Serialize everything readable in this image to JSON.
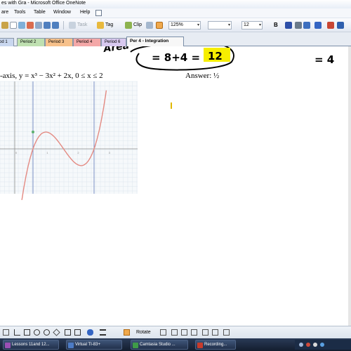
{
  "window": {
    "title": "es with Gra - Microsoft Office OneNote"
  },
  "menu": {
    "items": [
      "are",
      "Tools",
      "Table",
      "Window",
      "Help"
    ]
  },
  "toolbar": {
    "task_label": "Task",
    "tag_label": "Tag",
    "clip_label": "Clip",
    "zoom_value": "125%",
    "font_size_value": "12",
    "bold_label": "B"
  },
  "tabs": [
    {
      "label": "od 1",
      "color": "#c9d7ef"
    },
    {
      "label": "Period 2",
      "color": "#bfe0b1"
    },
    {
      "label": "Period 3",
      "color": "#f7c18b"
    },
    {
      "label": "Period 4",
      "color": "#f4a8a8"
    },
    {
      "label": "Period 6",
      "color": "#d8c9ef"
    },
    {
      "label": "Per 4 - Integration",
      "color": "#f7f7f7",
      "active": true
    }
  ],
  "page": {
    "handwriting_area": "Area",
    "handwriting_sum": "= 8+4 =",
    "handwriting_result": "12",
    "handwriting_right": "= 4",
    "problem_text": "-axis, y = x³ − 3x² + 2x, 0 ≤ x ≤ 2",
    "answer_text": "Answer: ½",
    "highlight_color": "#f6ee00",
    "curve_color": "#e48a82"
  },
  "graph": {
    "x_tick_labels": [
      "-1",
      "0",
      "1",
      "2",
      "3"
    ]
  },
  "drawbar": {
    "rotate_label": "Rotate"
  },
  "taskbar": {
    "items": [
      {
        "label": "Lessons 11and 12...",
        "icon_color": "#9b4fb4"
      },
      {
        "label": "Virtual TI-83+",
        "icon_color": "#4c7bc4"
      },
      {
        "label": "Camtasia Studio ...",
        "icon_color": "#3f9b48"
      },
      {
        "label": "Recording...",
        "icon_color": "#c83b2b"
      }
    ]
  }
}
